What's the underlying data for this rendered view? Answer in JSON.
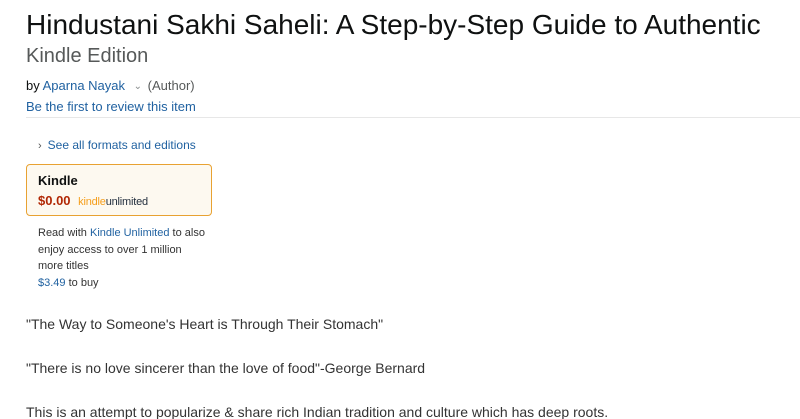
{
  "product": {
    "title": "Hindustani Sakhi Saheli: A Step-by-Step Guide to Authentic",
    "edition": "Kindle Edition"
  },
  "byline": {
    "prefix": "by",
    "author": "Aparna Nayak",
    "role": "(Author)"
  },
  "review_link": "Be the first to review this item",
  "formats": {
    "see_all_label": "See all formats and editions",
    "selected": {
      "name": "Kindle",
      "price": "$0.00",
      "badge_kindle": "kindle",
      "badge_unlimited": "unlimited"
    }
  },
  "ku_note": {
    "prefix": "Read with",
    "link": "Kindle Unlimited",
    "middle": "to also enjoy access to over 1 million more titles",
    "buy_price": "$3.49",
    "buy_suffix": "to buy"
  },
  "description": [
    "\"The Way to Someone's Heart is Through Their Stomach\"",
    "\"There is no love sincerer than the love of food\"-George Bernard",
    "This is an attempt to popularize & share rich Indian tradition and culture which has deep roots."
  ],
  "colors": {
    "link": "#2162a1",
    "price": "#b12704",
    "selected_border": "#e8a232",
    "kindle_orange": "#f59e1b"
  }
}
